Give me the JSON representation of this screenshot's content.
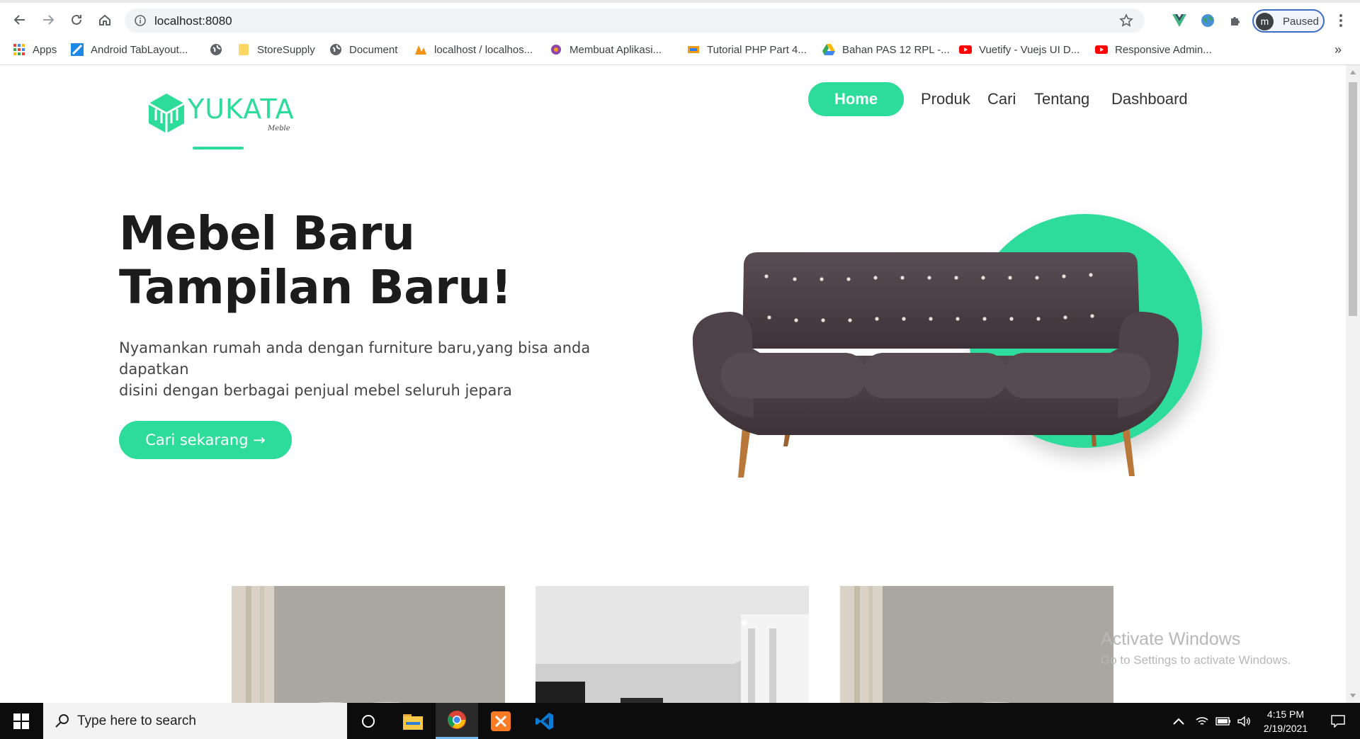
{
  "browser": {
    "url": "localhost:8080",
    "profile_initial": "m",
    "profile_status": "Paused",
    "icons": {
      "back": "arrow-left-icon",
      "forward": "arrow-right-icon",
      "reload": "reload-icon",
      "home": "home-icon",
      "site_info": "info-icon",
      "star": "star-icon",
      "extensions": "puzzle-icon",
      "menu": "kebab-menu-icon"
    }
  },
  "bookmarks": [
    {
      "label": "Apps",
      "icon": "apps-grid-icon"
    },
    {
      "label": "Android TabLayout...",
      "icon": "android-icon"
    },
    {
      "label": "",
      "icon": "globe-icon"
    },
    {
      "label": "StoreSupply",
      "icon": "folder-icon"
    },
    {
      "label": "Document",
      "icon": "globe-icon"
    },
    {
      "label": "localhost / localhos...",
      "icon": "phpmyadmin-icon"
    },
    {
      "label": "Membuat Aplikasi...",
      "icon": "site-icon"
    },
    {
      "label": "Tutorial PHP Part 4...",
      "icon": "site-icon"
    },
    {
      "label": "Bahan PAS 12 RPL -...",
      "icon": "google-drive-icon"
    },
    {
      "label": "Vuetify - Vuejs UI D...",
      "icon": "youtube-icon"
    },
    {
      "label": "Responsive Admin...",
      "icon": "youtube-icon"
    }
  ],
  "bookmarks_overflow": "»",
  "site": {
    "brand": "YUKATA",
    "brand_sub": "Meble",
    "nav": [
      "Home",
      "Produk",
      "Cari",
      "Tentang",
      "Dashboard"
    ],
    "hero_title_line1": "Mebel Baru",
    "hero_title_line2": "Tampilan Baru!",
    "hero_desc_line1": "Nyamankan rumah anda dengan furniture baru,yang bisa anda dapatkan",
    "hero_desc_line2": "disini dengan berbagai penjual mebel seluruh jepara",
    "cta": "Cari sekarang →",
    "accent_color": "#2ddb9a"
  },
  "watermark": {
    "line1": "Activate Windows",
    "line2": "Go to Settings to activate Windows."
  },
  "taskbar": {
    "search_placeholder": "Type here to search",
    "time": "4:15 PM",
    "date": "2/19/2021",
    "apps": [
      "task-view-icon",
      "file-explorer-icon",
      "chrome-icon",
      "xampp-icon",
      "vscode-icon"
    ]
  }
}
